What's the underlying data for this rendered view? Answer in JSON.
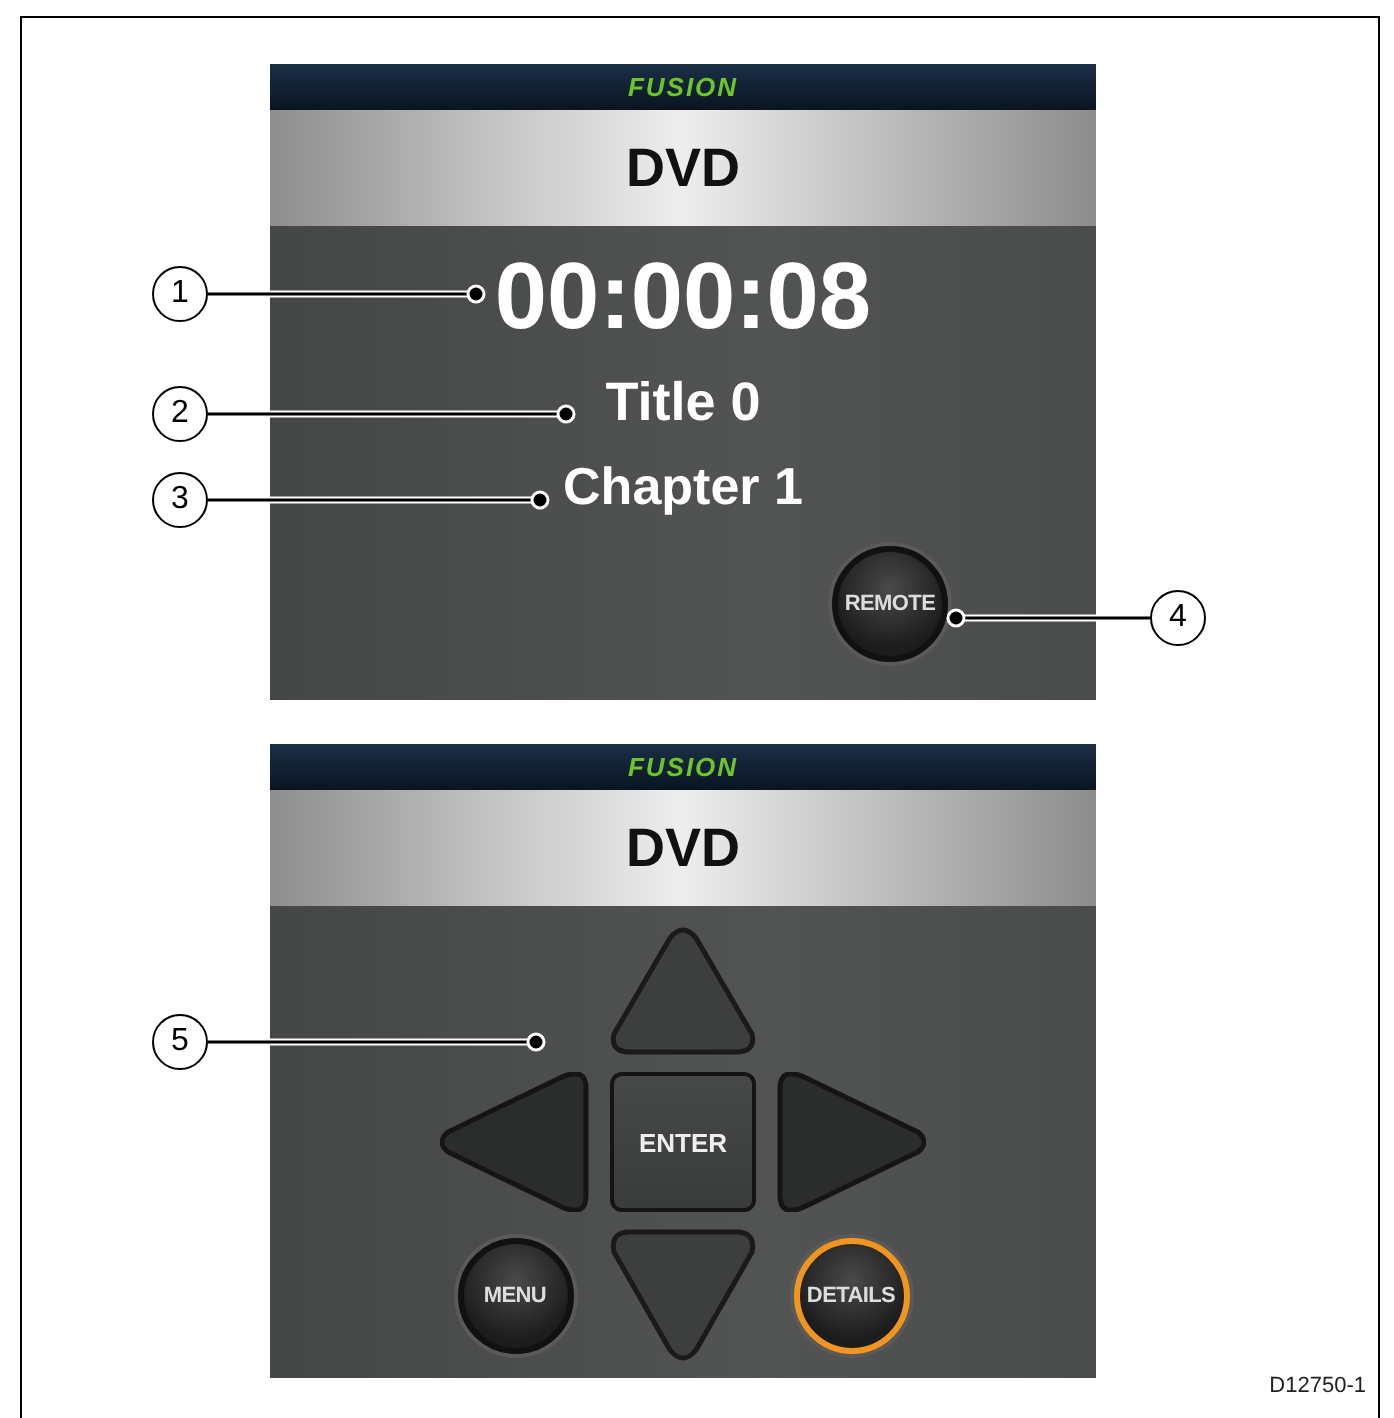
{
  "screens": [
    {
      "kind": "playback",
      "logo": "FUSION",
      "title": "DVD",
      "elapsed": "00:00:08",
      "title_line": "Title 0",
      "chapter": "Chapter 1",
      "remote_button": "REMOTE"
    },
    {
      "kind": "remote",
      "logo": "FUSION",
      "title": "DVD",
      "enter_button": "ENTER",
      "menu_button": "MENU",
      "details_button": "DETAILS",
      "details_selected": true
    }
  ],
  "callouts": [
    "1",
    "2",
    "3",
    "4",
    "5"
  ],
  "figure_id": "D12750-1"
}
